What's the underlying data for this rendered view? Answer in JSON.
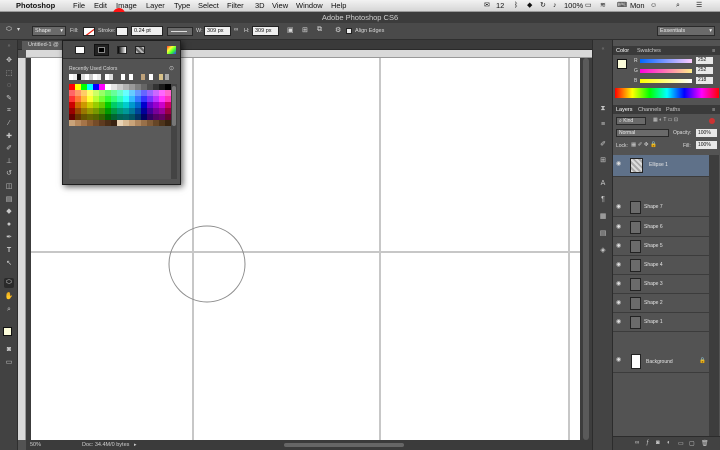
{
  "menubar": {
    "app_name": "Photoshop",
    "items": [
      "File",
      "Edit",
      "Image",
      "Layer",
      "Type",
      "Select",
      "Filter",
      "3D",
      "View",
      "Window",
      "Help"
    ],
    "status": {
      "notifications": "12",
      "battery": "100%",
      "day": "Mon"
    }
  },
  "window": {
    "title": "Adobe Photoshop CS6"
  },
  "options": {
    "mode_value": "Shape",
    "fill_label": "Fill:",
    "stroke_label": "Stroke:",
    "stroke_width": "0.24 pt",
    "w_label": "W:",
    "w_value": "309 px",
    "h_label": "H:",
    "h_value": "309 px",
    "align_edges_label": "Align Edges",
    "workspace_value": "Essentials"
  },
  "document": {
    "tab_label": "Untitled-1 @",
    "zoom": "50%",
    "doc_info": "Doc: 34.4M/0 bytes"
  },
  "picker": {
    "recent_label": "Recently Used Colors"
  },
  "color_panel": {
    "tabs": [
      "Color",
      "Swatches"
    ],
    "channels": [
      {
        "label": "R",
        "value": "252"
      },
      {
        "label": "G",
        "value": "252"
      },
      {
        "label": "B",
        "value": "218"
      }
    ]
  },
  "layers_panel": {
    "tabs": [
      "Layers",
      "Channels",
      "Paths"
    ],
    "kind_label": "Kind",
    "blend_mode": "Normal",
    "opacity_label": "Opacity:",
    "opacity_value": "100%",
    "lock_label": "Lock:",
    "fill_label": "Fill:",
    "fill_value": "100%",
    "layers": [
      {
        "name": "Ellipse 1",
        "selected": true
      },
      {
        "name": "Shape 7"
      },
      {
        "name": "Shape 6"
      },
      {
        "name": "Shape 5"
      },
      {
        "name": "Shape 4"
      },
      {
        "name": "Shape 3"
      },
      {
        "name": "Shape 2"
      },
      {
        "name": "Shape 1"
      },
      {
        "name": "Background"
      }
    ]
  },
  "colors": {
    "annotation": "#ff1313",
    "selected_layer": "#5f7189",
    "canvas": "#e9e9e9",
    "guide": "#c7c7c7"
  }
}
